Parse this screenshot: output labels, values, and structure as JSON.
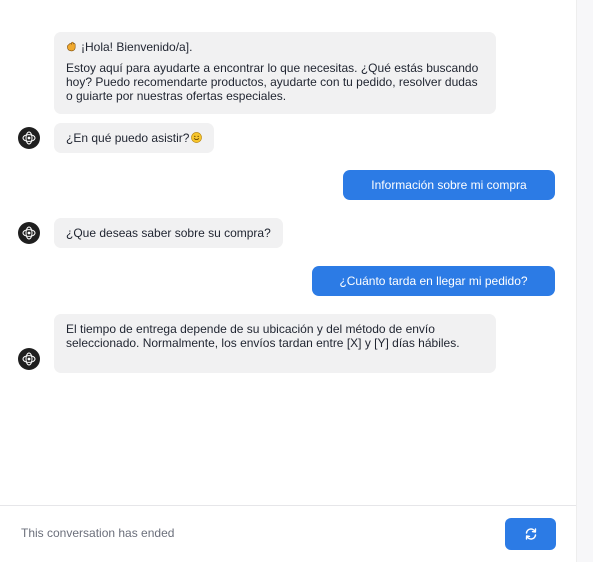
{
  "messages": {
    "welcome_title": "¡Hola! Bienvenido/a].",
    "welcome_body": "Estoy aquí para ayudarte a encontrar lo que necesitas. ¿Qué estás buscando hoy? Puedo recomendarte productos, ayudarte con tu pedido, resolver dudas o guiarte por nuestras ofertas especiales.",
    "assist_question": "¿En qué puedo asistir?",
    "user_purchase_info": "Información sobre mi compra",
    "bot_what_to_know": "¿Que deseas saber sobre su compra?",
    "user_delivery_time": "¿Cuánto tarda en llegar mi pedido?",
    "bot_delivery_answer": "El tiempo de entrega depende de su ubicación y del método de envío seleccionado. Normalmente, los envíos tardan entre [X] y [Y] días hábiles."
  },
  "footer": {
    "status_text": "This conversation has ended",
    "restart_icon": "refresh-icon"
  },
  "colors": {
    "user_bubble": "#2c7be5",
    "bot_bubble": "#f1f1f2",
    "avatar": "#1f1f1f"
  }
}
